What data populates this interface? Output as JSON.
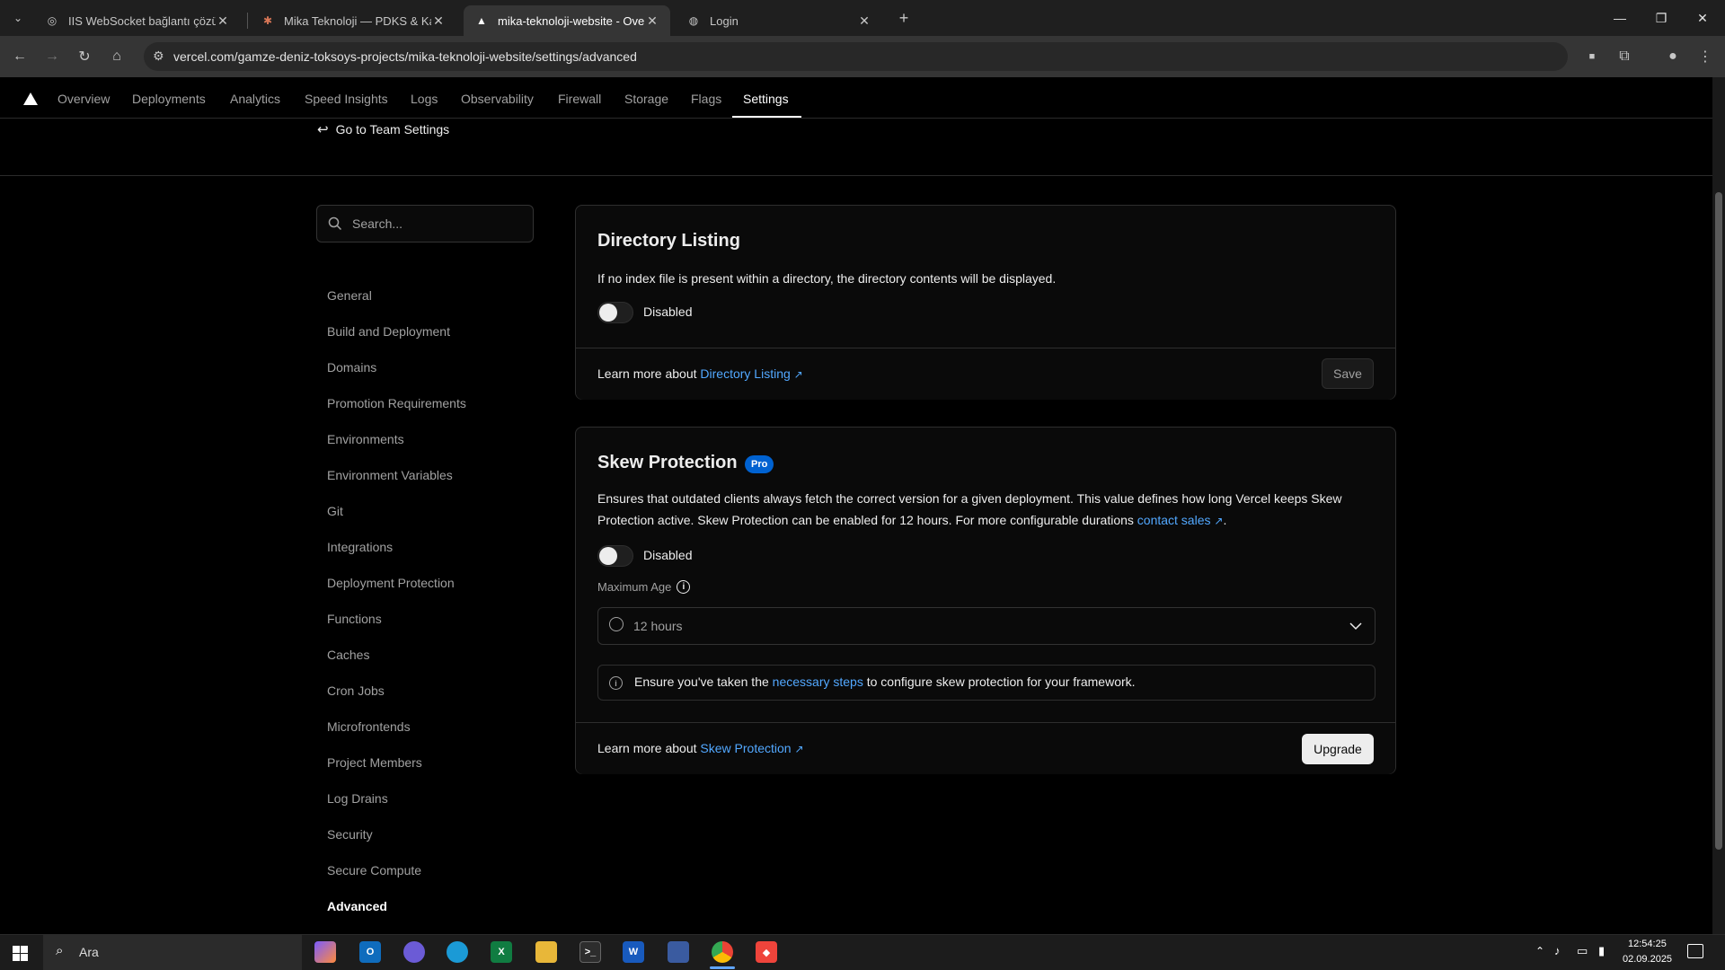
{
  "browser": {
    "tabs": [
      {
        "title": "IIS WebSocket bağlantı çözümü",
        "active": false
      },
      {
        "title": "Mika Teknoloji — PDKS & Kartl",
        "active": false
      },
      {
        "title": "mika-teknoloji-website - Overvi",
        "active": true
      },
      {
        "title": "Login",
        "active": false
      }
    ],
    "url": "vercel.com/gamze-deniz-toksoys-projects/mika-teknoloji-website/settings/advanced"
  },
  "topnav": {
    "items": [
      "Overview",
      "Deployments",
      "Analytics",
      "Speed Insights",
      "Logs",
      "Observability",
      "Firewall",
      "Storage",
      "Flags",
      "Settings"
    ],
    "active": "Settings"
  },
  "back_link": "Go to Team Settings",
  "sidebar": {
    "search_placeholder": "Search...",
    "items": [
      "General",
      "Build and Deployment",
      "Domains",
      "Promotion Requirements",
      "Environments",
      "Environment Variables",
      "Git",
      "Integrations",
      "Deployment Protection",
      "Functions",
      "Caches",
      "Cron Jobs",
      "Microfrontends",
      "Project Members",
      "Log Drains",
      "Security",
      "Secure Compute",
      "Advanced"
    ],
    "active": "Advanced"
  },
  "directory_listing": {
    "title": "Directory Listing",
    "description": "If no index file is present within a directory, the directory contents will be displayed.",
    "toggle_label": "Disabled",
    "learn_more_prefix": "Learn more about ",
    "learn_more_link": "Directory Listing",
    "save_label": "Save"
  },
  "skew_protection": {
    "title": "Skew Protection",
    "badge": "Pro",
    "description_line1": "Ensures that outdated clients always fetch the correct version for a given deployment. This value defines how long Vercel keeps Skew",
    "description_line2": "Protection active. Skew Protection can be enabled for 12 hours. For more configurable durations ",
    "contact_link": "contact sales",
    "description_end": ".",
    "toggle_label": "Disabled",
    "max_age_label": "Maximum Age",
    "max_age_value": "12 hours",
    "notice_prefix": "Ensure you've taken the ",
    "notice_link": "necessary steps",
    "notice_suffix": " to configure skew protection for your framework.",
    "learn_more_prefix": "Learn more about ",
    "learn_more_link": "Skew Protection",
    "upgrade_label": "Upgrade"
  },
  "taskbar": {
    "search_placeholder": "Ara",
    "time": "12:54:25",
    "date": "02.09.2025"
  },
  "colors": {
    "link": "#52a8ff",
    "pro_badge": "#0062d1",
    "background": "#000000"
  }
}
